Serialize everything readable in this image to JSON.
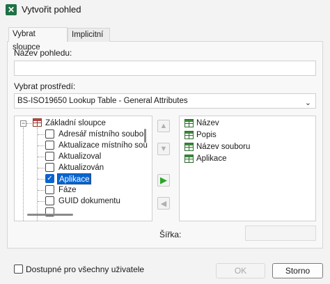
{
  "window": {
    "title": "Vytvořit pohled",
    "icon": "excel-app-icon"
  },
  "tabs": [
    {
      "label": "Vybrat sloupce",
      "ul": "y",
      "active": true
    },
    {
      "label": "Implicitní",
      "ul": "I",
      "active": false
    }
  ],
  "view_name": {
    "label": "Název pohledu:",
    "value": ""
  },
  "environment": {
    "label": "Vybrat prostředí:",
    "selected": "BS-ISO19650 Lookup Table - General Attributes"
  },
  "tree": {
    "root": "Základní sloupce",
    "items": [
      {
        "label": "Adresář místního soubor",
        "checked": false
      },
      {
        "label": "Aktualizace místního sou",
        "checked": false
      },
      {
        "label": "Aktualizoval",
        "checked": false
      },
      {
        "label": "Aktualizován",
        "checked": false
      },
      {
        "label": "Aplikace",
        "checked": true
      },
      {
        "label": "Fáze",
        "checked": false
      },
      {
        "label": "GUID dokumentu",
        "checked": false
      }
    ]
  },
  "selected_columns": [
    "Název",
    "Popis",
    "Název souboru",
    "Aplikace"
  ],
  "width": {
    "label": "Šířka:",
    "value": ""
  },
  "footer": {
    "all_users_label": "Dostupné pro všechny uživatele",
    "ok_label": "OK",
    "cancel_label": "Storno"
  }
}
